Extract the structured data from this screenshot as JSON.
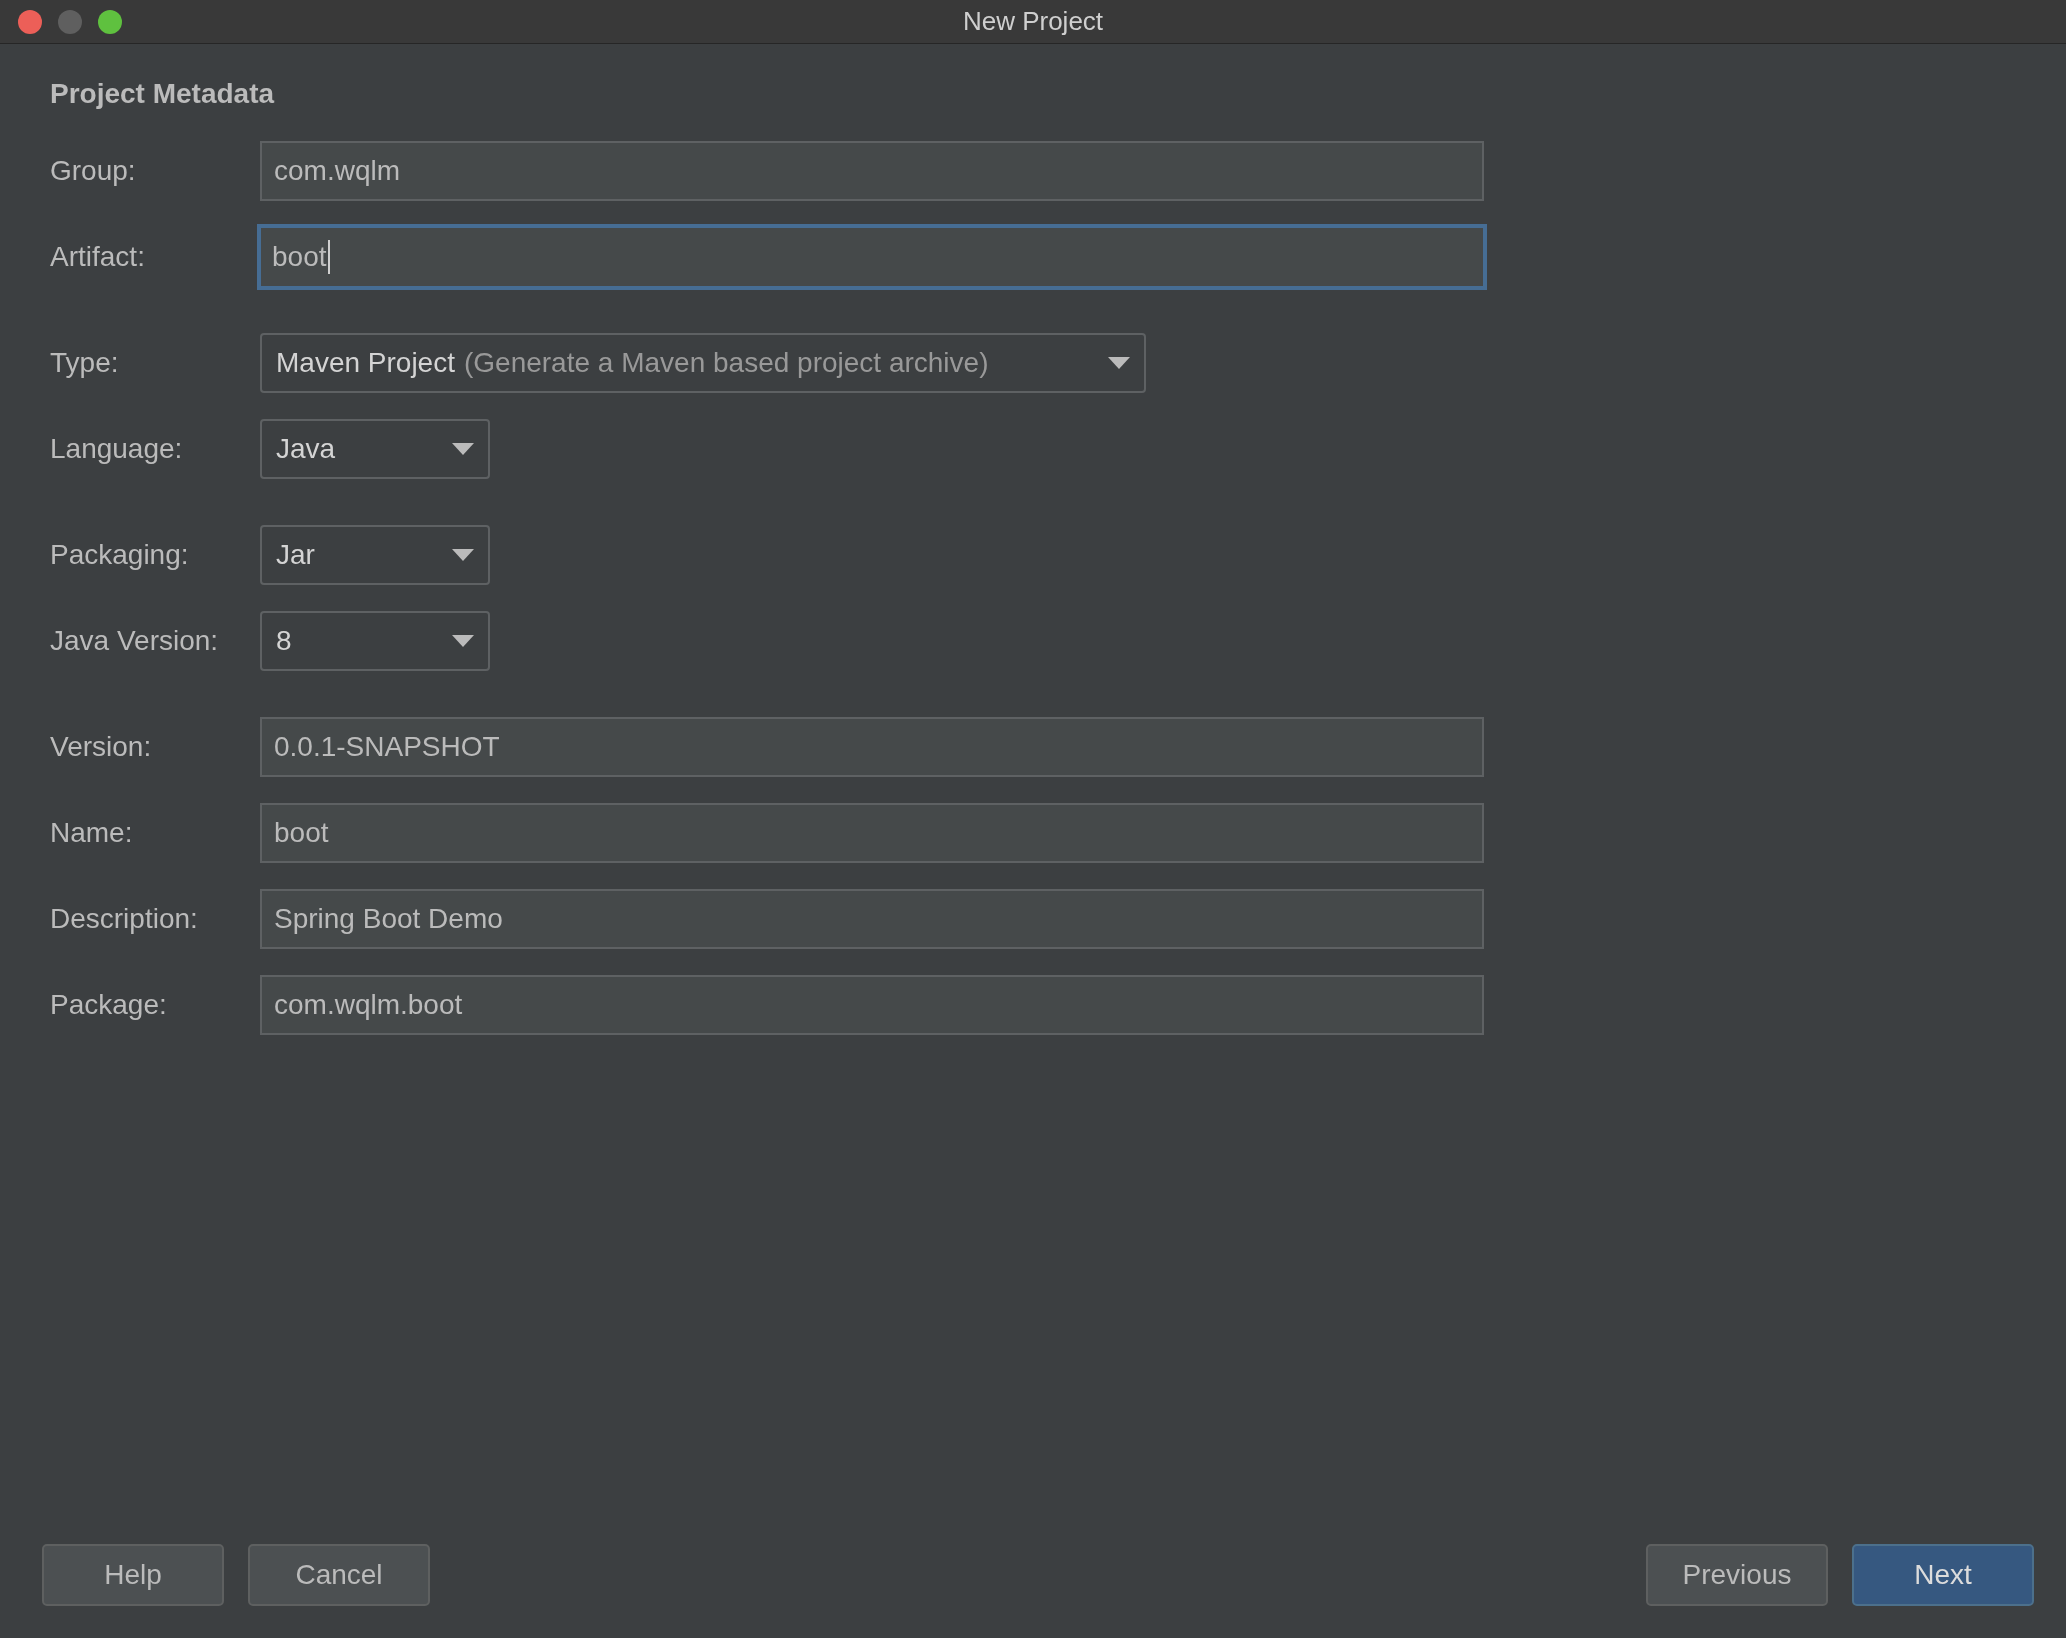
{
  "window": {
    "title": "New Project"
  },
  "section_title": "Project Metadata",
  "fields": [
    {
      "kind": "text",
      "label": "Group:",
      "value": "com.wqlm",
      "focused": false
    },
    {
      "kind": "text",
      "label": "Artifact:",
      "value": "boot",
      "focused": true
    },
    {
      "kind": "combo",
      "label": "Type:",
      "value": "Maven Project",
      "hint": "(Generate a Maven based project archive)"
    },
    {
      "kind": "combo",
      "label": "Language:",
      "value": "Java"
    },
    {
      "kind": "combo",
      "label": "Packaging:",
      "value": "Jar"
    },
    {
      "kind": "combo",
      "label": "Java Version:",
      "value": "8"
    },
    {
      "kind": "text",
      "label": "Version:",
      "value": "0.0.1-SNAPSHOT",
      "focused": false
    },
    {
      "kind": "text",
      "label": "Name:",
      "value": "boot",
      "focused": false
    },
    {
      "kind": "text",
      "label": "Description:",
      "value": "Spring Boot Demo",
      "focused": false
    },
    {
      "kind": "text",
      "label": "Package:",
      "value": "com.wqlm.boot",
      "focused": false
    }
  ],
  "buttons_left": [
    {
      "label": "Help",
      "default": false
    },
    {
      "label": "Cancel",
      "default": false
    }
  ],
  "buttons_right": [
    {
      "label": "Previous",
      "default": false
    },
    {
      "label": "Next",
      "default": true
    }
  ]
}
